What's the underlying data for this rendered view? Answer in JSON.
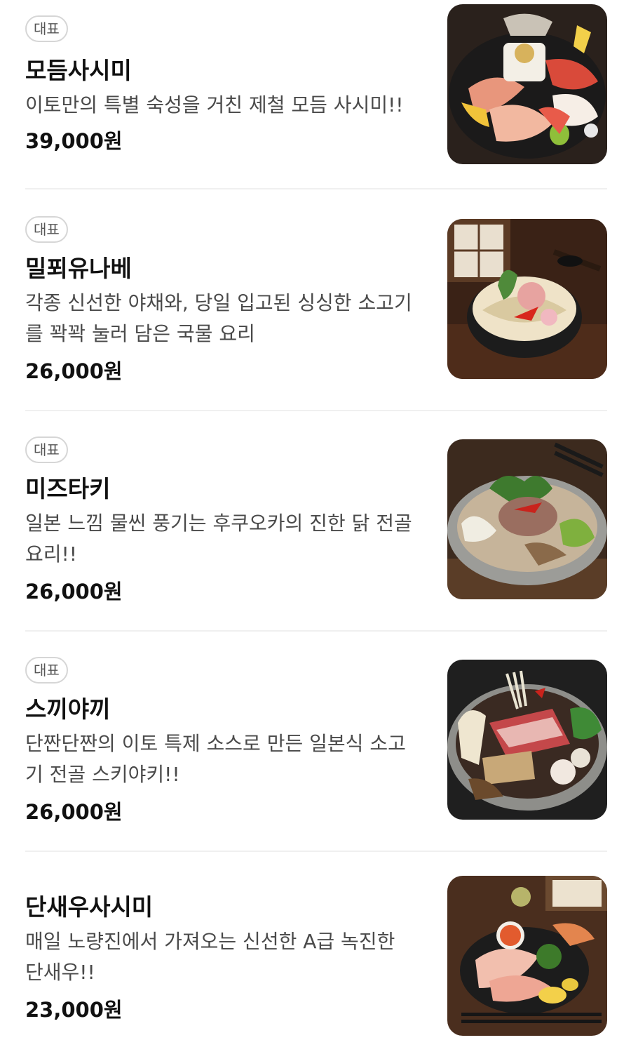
{
  "menu": {
    "items": [
      {
        "badge": "대표",
        "name": "모듬사시미",
        "desc": "이토만의 특별 숙성을 거친 제철 모듬 사시미!!",
        "price": "39,000원",
        "image": "sashimi-platter-photo"
      },
      {
        "badge": "대표",
        "name": "밀푀유나베",
        "desc": "각종 신선한 야채와, 당일 입고된 싱싱한 소고기를 꽉꽉 눌러 담은 국물 요리",
        "price": "26,000원",
        "image": "mille-feuille-nabe-photo"
      },
      {
        "badge": "대표",
        "name": "미즈타키",
        "desc": "일본 느낌 물씬 풍기는 후쿠오카의 진한 닭 전골 요리!!",
        "price": "26,000원",
        "image": "mizutaki-photo"
      },
      {
        "badge": "대표",
        "name": "스끼야끼",
        "desc": "단짠단짠의 이토 특제 소스로 만든 일본식 소고기 전골 스키야키!!",
        "price": "26,000원",
        "image": "sukiyaki-photo"
      },
      {
        "name": "단새우사시미",
        "desc": "매일 노량진에서 가져오는 신선한 A급 녹진한 단새우!!",
        "price": "23,000원",
        "image": "sweet-shrimp-sashimi-photo"
      }
    ]
  }
}
